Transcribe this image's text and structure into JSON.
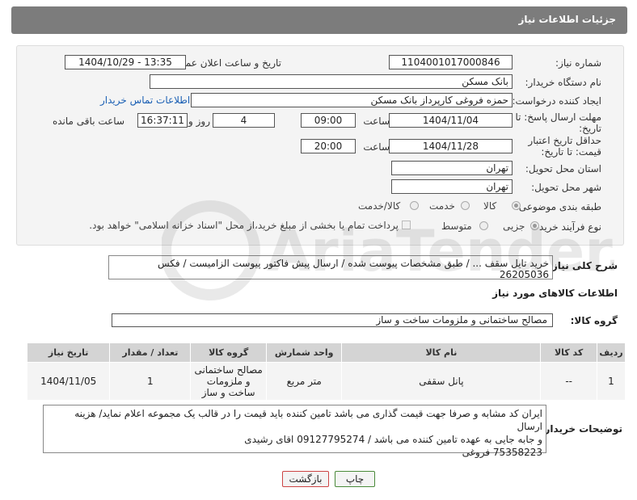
{
  "header": {
    "title": "جزئیات اطلاعات نیاز"
  },
  "fields": {
    "need_number_label": "شماره نیاز:",
    "need_number": "1104001017000846",
    "announce_label": "تاریخ و ساعت اعلان عمومی:",
    "announce_value": "1404/10/29 - 13:35",
    "buyer_org_label": "نام دستگاه خریدار:",
    "buyer_org": "بانک مسکن",
    "creator_label": "ایجاد کننده درخواست:",
    "creator": "حمزه فروغی کارپرداز بانک مسکن",
    "contact_link": "اطلاعات تماس خریدار",
    "reply_deadline_label": "مهلت ارسال پاسخ: تا تاریخ:",
    "reply_date": "1404/11/04",
    "time_label": "ساعت",
    "reply_time": "09:00",
    "days": "4",
    "days_label": "روز و",
    "remaining": "16:37:11",
    "remaining_label": "ساعت باقی مانده",
    "price_validity_label": "حداقل تاریخ اعتبار قیمت: تا تاریخ:",
    "validity_date": "1404/11/28",
    "time_label2": "ساعت",
    "validity_time": "20:00",
    "province_label": "استان محل تحویل:",
    "province": "تهران",
    "city_label": "شهر محل تحویل:",
    "city": "تهران",
    "category_label": "طبقه بندی موضوعی:",
    "category_options": [
      "کالا",
      "خدمت",
      "کالا/خدمت"
    ],
    "purchase_type_label": "نوع فرآیند خرید :",
    "purchase_options": [
      "جزیی",
      "متوسط"
    ],
    "payment_note": "پرداخت تمام یا بخشی از مبلغ خرید،از محل \"اسناد خزانه اسلامی\" خواهد بود."
  },
  "description": {
    "label": "شرح کلی نیاز:",
    "text": "خرید تایل سقف ... / طبق مشخصات پیوست شده / ارسال پیش فاکتور پیوست الزامیست / فکس 26205036"
  },
  "goods": {
    "section_title": "اطلاعات کالاهای مورد نیاز",
    "group_label": "گروه کالا:",
    "group_value": "مصالح ساختمانی و ملزومات ساخت و ساز",
    "columns": [
      "ردیف",
      "کد کالا",
      "نام کالا",
      "واحد شمارش",
      "گروه کالا",
      "تعداد / مقدار",
      "تاریخ نیاز"
    ],
    "rows": [
      [
        "1",
        "--",
        "پانل سقفی",
        "متر مربع",
        "مصالح ساختمانی و ملزومات ساخت و ساز",
        "1",
        "1404/11/05"
      ]
    ]
  },
  "buyer_notes": {
    "label": "توضیحات خریدار:",
    "line1": "ایران کد مشابه و صرفا جهت قیمت گذاری می باشد تامین کننده باید قیمت را در قالب یک مجموعه اعلام نماید/ هزینه ارسال",
    "line2": "و جابه جایی به عهده تامین کننده می باشد / 09127795274 اقای رشیدی",
    "line3": "75358223 فروغی"
  },
  "buttons": {
    "print": "چاپ",
    "back": "بازگشت"
  },
  "watermark_text": "AriaTender.net"
}
